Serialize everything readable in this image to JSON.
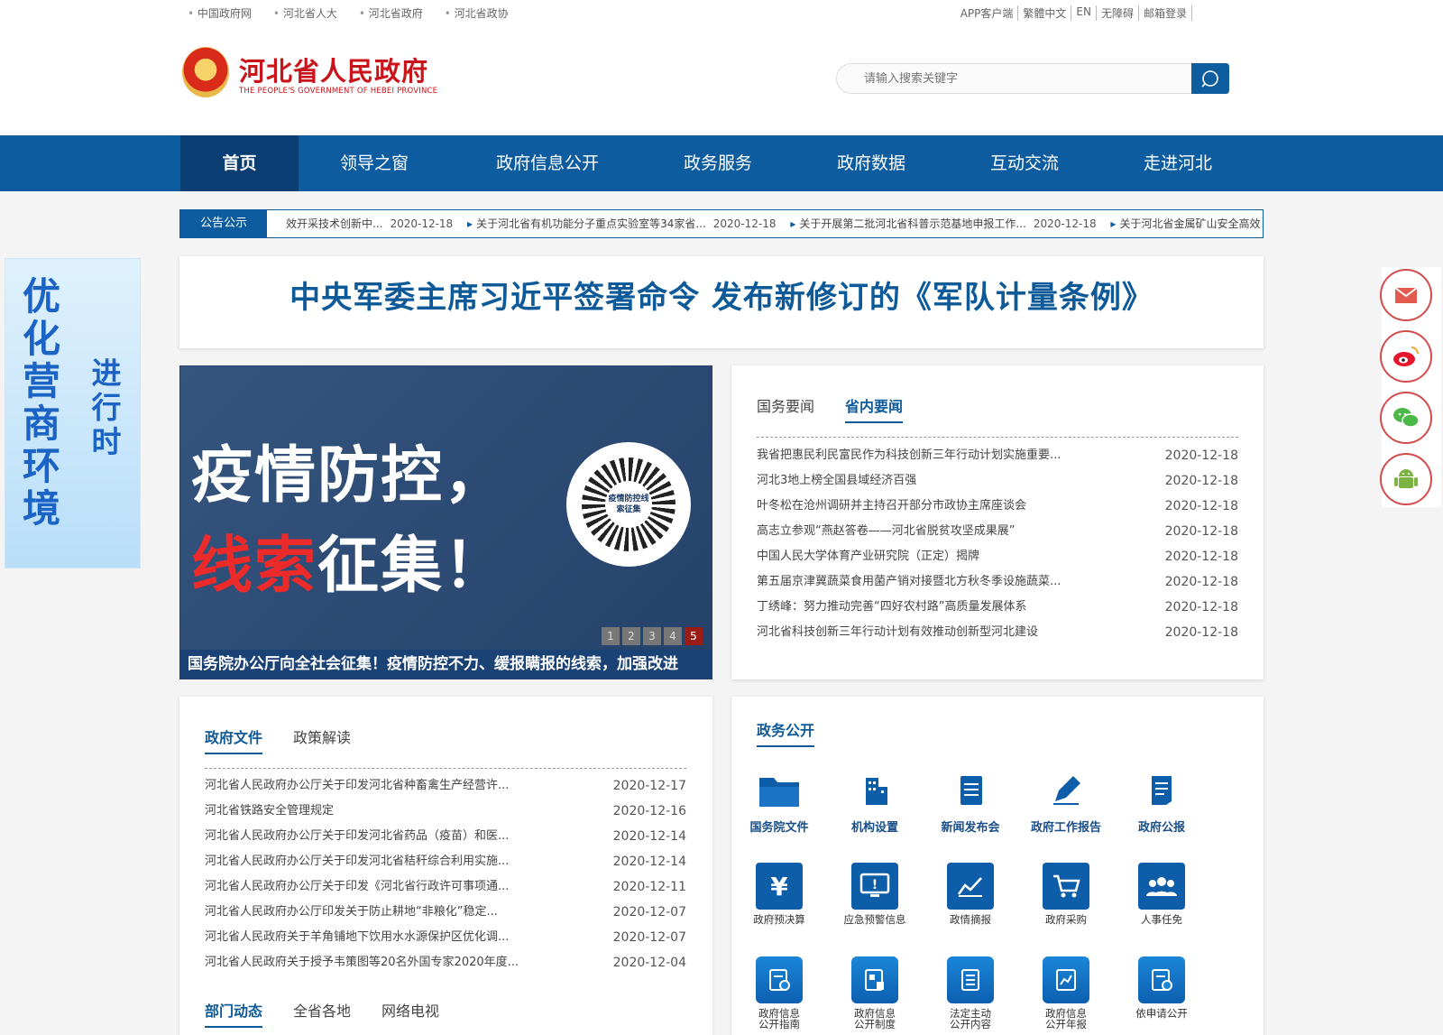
{
  "top_links": [
    "中国政府网",
    "河北省人大",
    "河北省政府",
    "河北省政协"
  ],
  "top_right": [
    "APP客户端",
    "繁體中文",
    "EN",
    "无障碍",
    "邮箱登录"
  ],
  "logo": {
    "cn": "河北省人民政府",
    "en": "THE PEOPLE'S GOVERNMENT OF HEBEI PROVINCE"
  },
  "search": {
    "placeholder": "请输入搜索关键字"
  },
  "nav": [
    "首页",
    "领导之窗",
    "政府信息公开",
    "政务服务",
    "政府数据",
    "互动交流",
    "走进河北"
  ],
  "notice": {
    "label": "公告公示",
    "items": [
      {
        "text": "效开采技术创新中...",
        "date": "2020-12-18"
      },
      {
        "text": "关于河北省有机功能分子重点实验室等34家省...",
        "date": "2020-12-18"
      },
      {
        "text": "关于开展第二批河北省科普示范基地申报工作...",
        "date": "2020-12-18"
      },
      {
        "text": "关于河北省金属矿山安全高效",
        "date": ""
      }
    ]
  },
  "headline": "中央军委主席习近平签署命令 发布新修订的《军队计量条例》",
  "banner": {
    "big": "优化营商环境",
    "small": "进行时"
  },
  "slide": {
    "line1": "疫情防控，",
    "line2_red": "线索",
    "line2_white": "征集！",
    "qr_label": "疫情防控线索征集",
    "dots": [
      "1",
      "2",
      "3",
      "4",
      "5"
    ],
    "caption": "国务院办公厅向全社会征集！疫情防控不力、缓报瞒报的线索，加强改进"
  },
  "news": {
    "tabs": [
      "国务要闻",
      "省内要闻"
    ],
    "items": [
      {
        "title": "我省把惠民利民富民作为科技创新三年行动计划实施重要...",
        "date": "2020-12-18"
      },
      {
        "title": "河北3地上榜全国县域经济百强",
        "date": "2020-12-18"
      },
      {
        "title": "叶冬松在沧州调研并主持召开部分市政协主席座谈会",
        "date": "2020-12-18"
      },
      {
        "title": "高志立参观“燕赵答卷——河北省脱贫攻坚成果展”",
        "date": "2020-12-18"
      },
      {
        "title": "中国人民大学体育产业研究院（正定）揭牌",
        "date": "2020-12-18"
      },
      {
        "title": "第五届京津冀蔬菜食用菌产销对接暨北方秋冬季设施蔬菜...",
        "date": "2020-12-18"
      },
      {
        "title": "丁绣峰：努力推动完善“四好农村路”高质量发展体系",
        "date": "2020-12-18"
      },
      {
        "title": "河北省科技创新三年行动计划有效推动创新型河北建设",
        "date": "2020-12-18"
      }
    ]
  },
  "docs": {
    "tabs": [
      "政府文件",
      "政策解读"
    ],
    "items": [
      {
        "title": "河北省人民政府办公厅关于印发河北省种畜禽生产经营许...",
        "date": "2020-12-17"
      },
      {
        "title": "河北省铁路安全管理规定",
        "date": "2020-12-16"
      },
      {
        "title": "河北省人民政府办公厅关于印发河北省药品（疫苗）和医...",
        "date": "2020-12-14"
      },
      {
        "title": "河北省人民政府办公厅关于印发河北省秸秆综合利用实施...",
        "date": "2020-12-14"
      },
      {
        "title": "河北省人民政府办公厅关于印发《河北省行政许可事项通...",
        "date": "2020-12-11"
      },
      {
        "title": "河北省人民政府办公厅印发关于防止耕地“非粮化”稳定...",
        "date": "2020-12-07"
      },
      {
        "title": "河北省人民政府关于羊角铺地下饮用水水源保护区优化调...",
        "date": "2020-12-07"
      },
      {
        "title": "河北省人民政府关于授予韦策图等20名外国专家2020年度...",
        "date": "2020-12-04"
      }
    ],
    "tabs2": [
      "部门动态",
      "全省各地",
      "网络电视"
    ]
  },
  "gov": {
    "title": "政务公开",
    "row1": [
      "国务院文件",
      "机构设置",
      "新闻发布会",
      "政府工作报告",
      "政府公报"
    ],
    "row2": [
      "政府预决算",
      "应急预警信息",
      "政情摘报",
      "政府采购",
      "人事任免"
    ],
    "row3": [
      [
        "政府信息",
        "公开指南"
      ],
      [
        "政府信息",
        "公开制度"
      ],
      [
        "法定主动",
        "公开内容"
      ],
      [
        "政府信息",
        "公开年报"
      ],
      [
        "依申请公开",
        ""
      ]
    ],
    "row2_icons": [
      "yuan-icon",
      "alert-monitor-icon",
      "chart-icon",
      "cart-icon",
      "people-icon"
    ]
  },
  "colors": {
    "primary": "#0d5c9f",
    "nav_active": "#0a3e72",
    "logo_red": "#c8141a",
    "headline": "#0e5a99"
  }
}
